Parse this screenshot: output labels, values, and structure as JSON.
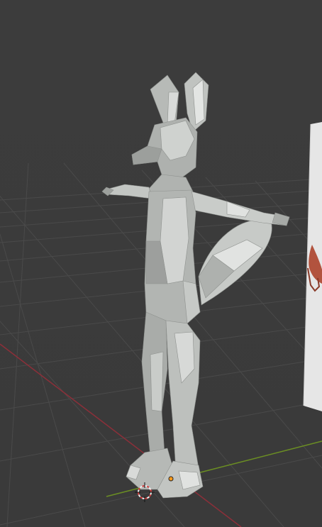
{
  "app": {
    "view": "3d-viewport",
    "mode": "object"
  },
  "scene": {
    "background_color": "#3d3d3d",
    "grid_color": "#4a4a4a",
    "x_axis_color": "#8c2f39",
    "y_axis_color": "#6b8e23",
    "model_color": "#b4b7b4",
    "reference_image_visible": true,
    "origin_color": "#ff9b1a"
  }
}
